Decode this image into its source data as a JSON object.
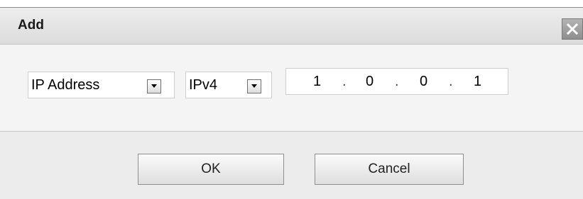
{
  "dialog": {
    "title": "Add",
    "close_icon": "close-icon"
  },
  "form": {
    "address_type": {
      "selected": "IP Address",
      "arrow_icon": "chevron-down-icon"
    },
    "ip_version": {
      "selected": "IPv4",
      "arrow_icon": "chevron-down-icon"
    },
    "ip_address": {
      "octets": [
        "1",
        "0",
        "0",
        "1"
      ],
      "separator": "."
    }
  },
  "buttons": {
    "ok_label": "OK",
    "cancel_label": "Cancel"
  }
}
